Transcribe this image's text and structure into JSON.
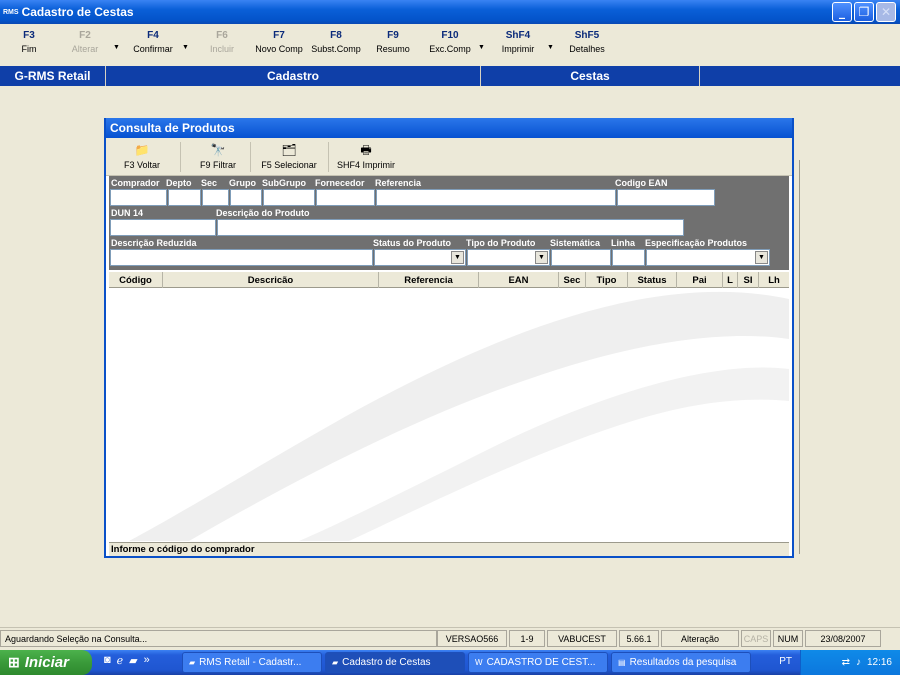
{
  "window": {
    "app_badge": "RMS",
    "title": "Cadastro de Cestas"
  },
  "fkeys": [
    {
      "key": "F3",
      "label": "Fim",
      "enabled": true
    },
    {
      "key": "F2",
      "label": "Alterar",
      "enabled": false
    },
    {
      "key": "F4",
      "label": "Confirmar",
      "enabled": true
    },
    {
      "key": "F6",
      "label": "Incluir",
      "enabled": false
    },
    {
      "key": "F7",
      "label": "Novo Comp",
      "enabled": true
    },
    {
      "key": "F8",
      "label": "Subst.Comp",
      "enabled": true
    },
    {
      "key": "F9",
      "label": "Resumo",
      "enabled": true
    },
    {
      "key": "F10",
      "label": "Exc.Comp",
      "enabled": true
    },
    {
      "key": "ShF4",
      "label": "Imprimir",
      "enabled": true
    },
    {
      "key": "ShF5",
      "label": "Detalhes",
      "enabled": true
    }
  ],
  "band": {
    "system": "G-RMS Retail",
    "module": "Cadastro",
    "entity": "Cestas"
  },
  "dialog": {
    "title": "Consulta de Produtos",
    "tools": [
      {
        "label": "F3 Voltar",
        "icon": "back-folder-icon"
      },
      {
        "label": "F9 Filtrar",
        "icon": "binoculars-icon"
      },
      {
        "label": "F5 Selecionar",
        "icon": "select-icon"
      },
      {
        "label": "SHF4 Imprimir",
        "icon": "printer-icon"
      }
    ],
    "filters": {
      "comprador": "Comprador",
      "depto": "Depto",
      "sec": "Sec",
      "grupo": "Grupo",
      "subgrupo": "SubGrupo",
      "fornecedor": "Fornecedor",
      "referencia": "Referencia",
      "codigo_ean": "Codigo EAN",
      "dun14": "DUN 14",
      "descricao_produto": "Descrição do Produto",
      "descricao_reduzida": "Descrição Reduzida",
      "status_produto": "Status do Produto",
      "tipo_produto": "Tipo do Produto",
      "sistematica": "Sistemática",
      "linha": "Linha",
      "especificacao": "Especificação Produtos"
    },
    "columns": [
      "Código",
      "Descricão",
      "Referencia",
      "EAN",
      "Sec",
      "Tipo",
      "Status",
      "Pai",
      "L",
      "SI",
      "Lh"
    ],
    "hint": "Informe o código do comprador"
  },
  "statusbar": {
    "message": "Aguardando Seleção na Consulta...",
    "version": "VERSAO566",
    "range": "1-9",
    "program": "VABUCEST",
    "build": "5.66.1",
    "mode": "Alteração",
    "caps": "CAPS",
    "num": "NUM",
    "date": "23/08/2007"
  },
  "taskbar": {
    "start": "Iniciar",
    "tasks": [
      "RMS Retail - Cadastr...",
      "Cadastro de Cestas",
      "CADASTRO DE CEST...",
      "Resultados da pesquisa"
    ],
    "lang": "PT",
    "clock": "12:16"
  }
}
